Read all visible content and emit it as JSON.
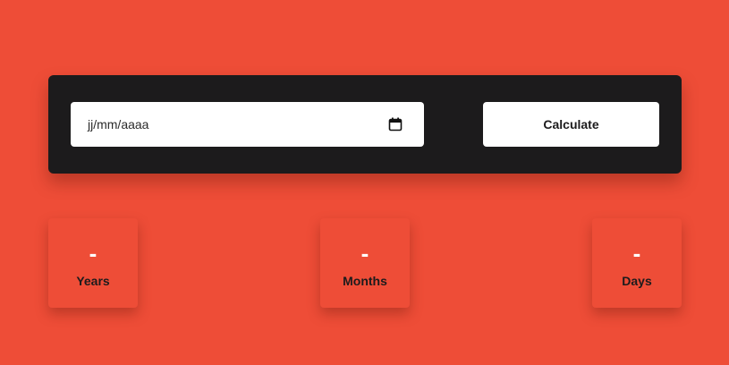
{
  "form": {
    "date_placeholder": "jj/mm/aaaa",
    "calendar_icon": "calendar-icon",
    "calculate_label": "Calculate"
  },
  "results": [
    {
      "value": "-",
      "label": "Years"
    },
    {
      "value": "-",
      "label": "Months"
    },
    {
      "value": "-",
      "label": "Days"
    }
  ],
  "colors": {
    "background": "#ee4d37",
    "panel": "#1c1b1c",
    "input": "#ffffff",
    "text_dark": "#1c1b1c",
    "value_text": "#ffffff"
  }
}
